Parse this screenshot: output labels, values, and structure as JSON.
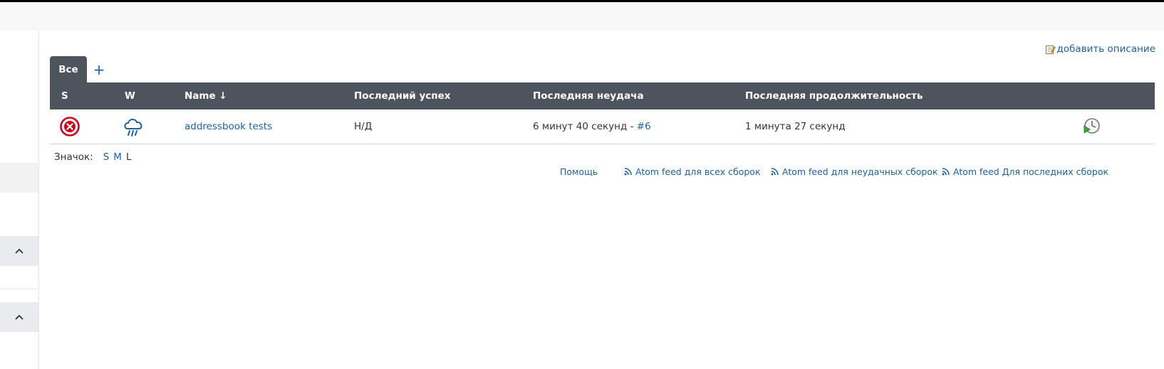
{
  "header": {
    "add_description": "добавить описание"
  },
  "tabs": {
    "active": "Все",
    "add": "+"
  },
  "table": {
    "columns": {
      "s": "S",
      "w": "W",
      "name": "Name ↓",
      "last_success": "Последний успех",
      "last_failure": "Последняя неудача",
      "last_duration": "Последняя продолжительность"
    },
    "rows": [
      {
        "status_icon": "failed-icon",
        "weather_icon": "rain-cloud-icon",
        "name": "addressbook tests",
        "last_success": "Н/Д",
        "last_failure_text": "6 минут 40 секунд - ",
        "last_failure_build": "#6",
        "last_duration": "1 минута 27 секунд",
        "action_icon": "schedule-build-icon"
      }
    ]
  },
  "legend": {
    "label": "Значок:",
    "sizes": [
      "S",
      "M",
      "L"
    ]
  },
  "footer": {
    "help": "Помощь",
    "atom_all": "Atom feed для всех сборок",
    "atom_failed": "Atom feed для неудачных сборок",
    "atom_latest": "Atom feed Для последних сборок"
  },
  "colors": {
    "header_bg": "#4d545d",
    "link": "#1a61a6",
    "failed": "#d0021b"
  }
}
